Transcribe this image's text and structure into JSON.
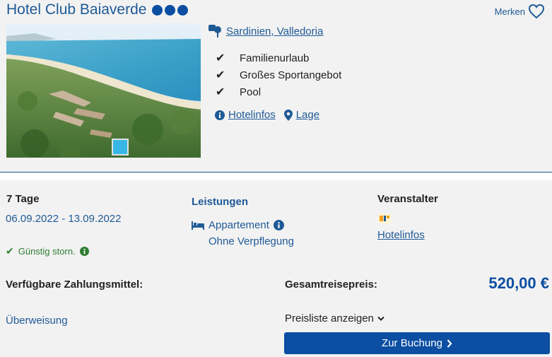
{
  "hotel": {
    "name": "Hotel Club Baiaverde",
    "rating_dots": 3,
    "save_label": "Merken",
    "location": "Sardinien, Valledoria",
    "features": [
      "Familienurlaub",
      "Großes Sportangebot",
      "Pool"
    ],
    "links": {
      "hotelinfo": "Hotelinfos",
      "lage": "Lage"
    },
    "photo_icon": "aerial-beach-photo"
  },
  "trip": {
    "duration": "7 Tage",
    "dates": "06.09.2022 - 13.09.2022",
    "cancellation": "Günstig storn."
  },
  "services": {
    "title": "Leistungen",
    "room": "Appartement",
    "meal": "Ohne Verpflegung"
  },
  "operator": {
    "title": "Veranstalter",
    "link": "Hotelinfos"
  },
  "payment": {
    "title": "Verfügbare Zahlungsmittel:",
    "method": "Überweisung"
  },
  "price": {
    "label": "Gesamtreisepreis:",
    "value": "520,00 €",
    "list_label": "Preisliste anzeigen",
    "book_label": "Zur Buchung"
  },
  "colors": {
    "accent": "#0b4ea2",
    "link": "#1f5a96",
    "success": "#2e7d32"
  }
}
